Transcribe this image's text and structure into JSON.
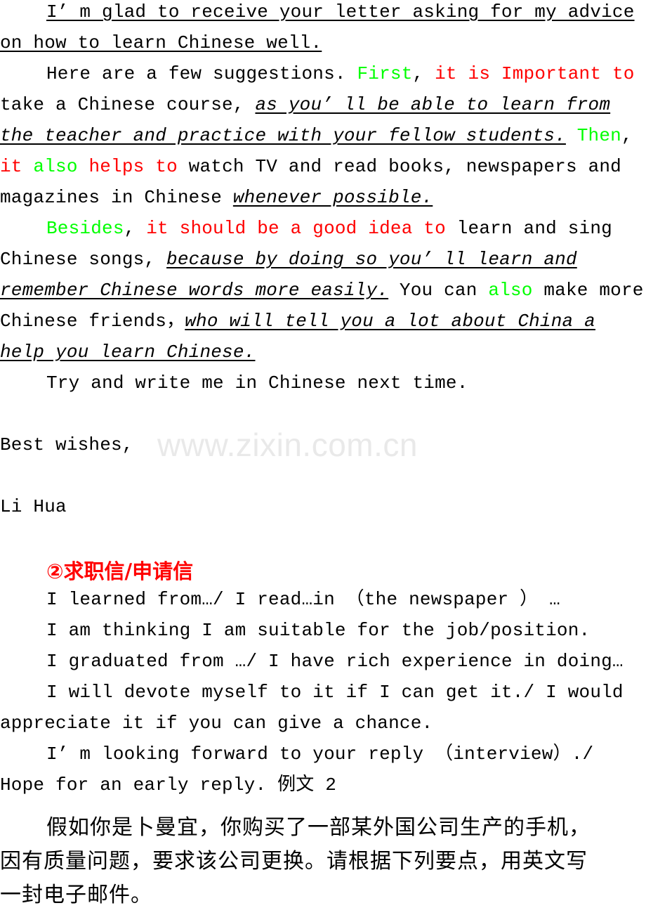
{
  "document": {
    "watermark": "www.zixin.com.cn",
    "colors": {
      "text": "#000000",
      "highlight_red": "#ff0000",
      "highlight_green": "#00ff00",
      "watermark": "#e9e9e9",
      "page_background": "#ffffff"
    }
  },
  "letter": {
    "line1_a": "I’ m glad to receive your letter asking for my advice",
    "line2_a": "on how to learn Chinese well.",
    "line3_a": "Here are a few suggestions. ",
    "line3_b": "First",
    "line3_c": ", ",
    "line3_d": "it is Important to",
    "line4_a": "take a Chinese course, ",
    "line4_b": "as you’ ll be able to learn from",
    "line5_a": "the teacher and practice with your fellow students.",
    "line5_b": " ",
    "line5_c": "Then",
    "line5_d": ",",
    "line6_a": "it",
    "line6_b": " ",
    "line6_c": "also",
    "line6_d": " ",
    "line6_e": "helps to",
    "line6_f": " watch TV and read books, newspapers and",
    "line7_a": "magazines in Chinese ",
    "line7_b": "whenever possible.",
    "line8_a": "Besides",
    "line8_b": ", ",
    "line8_c": "it should be a good idea to",
    "line8_d": " learn and sing",
    "line9_a": "Chinese songs, ",
    "line9_b": "because by doing so you’ ll learn and",
    "line10_a": "remember Chinese words more easily.",
    "line10_b": " You can ",
    "line10_c": "also",
    "line10_d": " make more",
    "line11_a": "Chinese friends，",
    "line11_b": "who will tell you a lot about China a",
    "line12_a": "help you learn Chinese.",
    "line13_a": "Try and write me in Chinese next time.",
    "closing": "Best wishes,",
    "signature": "Li Hua"
  },
  "section2": {
    "heading": "②求职信/申请信",
    "phrases": [
      "I learned from…/ I read…in （the newspaper ） …",
      "I am thinking I am suitable for the job/position.",
      "I graduated from …/ I have rich experience in doing…",
      "I will devote myself to it if I can get it./ I would",
      "appreciate it if you can give a chance.",
      "I’ m looking forward to your reply （interview）./",
      "Hope for an early reply. 例文 2"
    ]
  },
  "prompt_cn": {
    "line1": "假如你是卜曼宜，你购买了一部某外国公司生产的手机，",
    "line2": "因有质量问题，要求该公司更换。请根据下列要点，用英文写",
    "line3": "一封电子邮件。"
  }
}
